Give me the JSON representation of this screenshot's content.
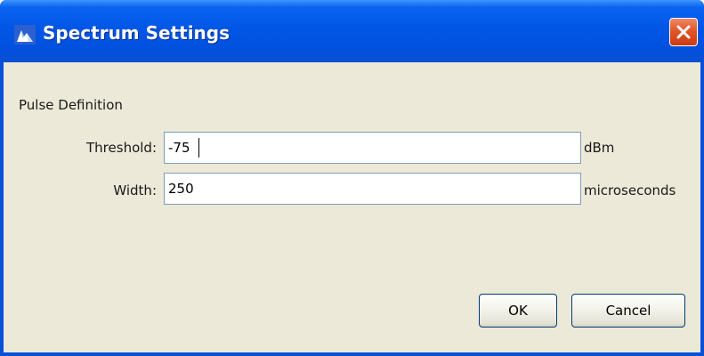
{
  "window": {
    "title": "Spectrum Settings",
    "app_icon": "spectrum-app-icon",
    "close_icon": "close-icon",
    "close_color": "#e2552a",
    "titlebar_color": "#0256e6",
    "client_bg": "#ece9d8"
  },
  "form": {
    "section_label": "Pulse Definition",
    "fields": [
      {
        "label": "Threshold:",
        "value": "-75",
        "unit": "dBm"
      },
      {
        "label": "Width:",
        "value": "250",
        "unit": "microseconds"
      }
    ]
  },
  "buttons": {
    "ok_label": "OK",
    "cancel_label": "Cancel"
  }
}
